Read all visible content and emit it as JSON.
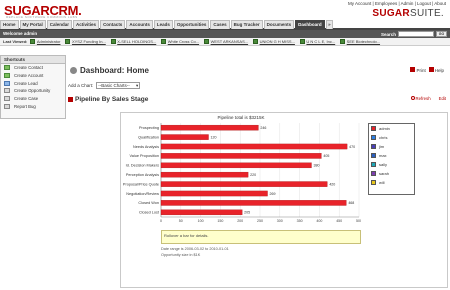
{
  "header": {
    "logo_text": "SUGARCRM.",
    "logo_tagline": "REPLACE SOFTWARE COMMONS LABS",
    "top_links": "My Account | Employees | Admin | Logout | About",
    "suite_logo_a": "SUGAR",
    "suite_logo_b": "SUITE."
  },
  "tabs": [
    {
      "label": "Home"
    },
    {
      "label": "My Portal"
    },
    {
      "label": "Calendar"
    },
    {
      "label": "Activities"
    },
    {
      "label": "Contacts"
    },
    {
      "label": "Accounts"
    },
    {
      "label": "Leads"
    },
    {
      "label": "Opportunities"
    },
    {
      "label": "Cases"
    },
    {
      "label": "Bug Tracker"
    },
    {
      "label": "Documents"
    },
    {
      "label": "Dashboard"
    },
    {
      "label": "»"
    }
  ],
  "welcome": "Welcome admin",
  "search": {
    "label": "Search",
    "button": "GO"
  },
  "last_viewed": {
    "label": "Last Viewed:",
    "items": [
      "Administrator",
      "XYSZ Funding In...",
      "X-SELL HOLDINGS...",
      "White Cross Co...",
      "WEST ARKANSAS...",
      "UNION G H MISS...",
      "U N C L E, Inc...",
      "SEE Biotechnolo..."
    ]
  },
  "shortcuts": {
    "title": "Shortcuts",
    "items": [
      "Create Contact",
      "Create Account",
      "Create Lead",
      "Create Opportunity",
      "Create Case",
      "Report Bug"
    ]
  },
  "page": {
    "title": "Dashboard: Home",
    "print": "Print",
    "help": "Help",
    "add_chart_label": "Add a Chart:",
    "add_chart_value": "--Basic Charts--"
  },
  "dashlet": {
    "title": "Pipeline By Sales Stage",
    "refresh": "Refresh",
    "edit": "Edit",
    "hover_text": "Rollover a bar for details.",
    "footnote1": "Date range is 2006-03-02 to 2010-01-01",
    "footnote2": "Opportunity size in $1K"
  },
  "chart_data": {
    "type": "bar",
    "orientation": "horizontal",
    "title": "Pipeline total is $3215K",
    "categories": [
      "Prospecting",
      "Qualification",
      "Needs Analysis",
      "Value Proposition",
      "Id. Decision Makers",
      "Perception Analysis",
      "Proposal/Price Quote",
      "Negotiation/Review",
      "Closed Won",
      "Closed Lost"
    ],
    "values": [
      246,
      120,
      470,
      405,
      380,
      220,
      420,
      269,
      468,
      205
    ],
    "xlim": [
      0,
      500
    ],
    "xticks": [
      0,
      50,
      100,
      150,
      200,
      250,
      300,
      350,
      400,
      450,
      500
    ],
    "bar_color": "#e8232a",
    "legend": [
      {
        "name": "admin",
        "color": "#e8232a"
      },
      {
        "name": "chris",
        "color": "#2b7de0"
      },
      {
        "name": "jim",
        "color": "#4a3fb8"
      },
      {
        "name": "max",
        "color": "#2a5fc0"
      },
      {
        "name": "sally",
        "color": "#1fa8b8"
      },
      {
        "name": "sarah",
        "color": "#7d3fb0"
      },
      {
        "name": "will",
        "color": "#e8c81c"
      }
    ]
  }
}
